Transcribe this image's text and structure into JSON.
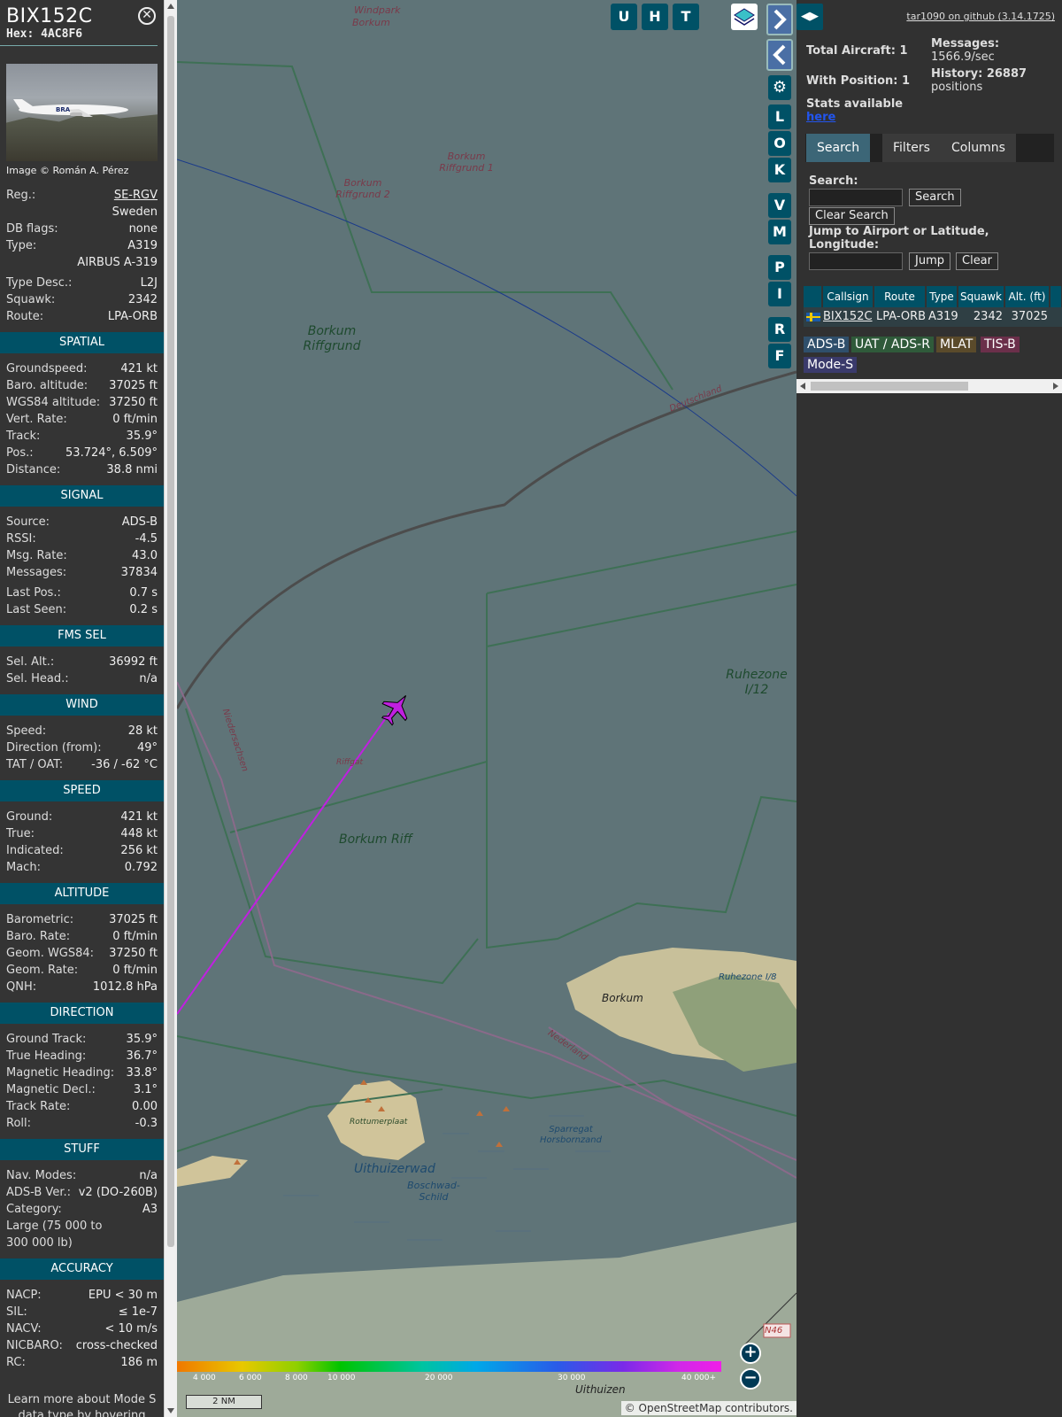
{
  "info": {
    "callsign": "BIX152C",
    "hex": "Hex: 4AC8F6",
    "image_credit": "Image © Román A. Pérez",
    "basic": [
      {
        "label": "Reg.:",
        "value": "SE-RGV"
      },
      {
        "label": "",
        "value": "Sweden"
      },
      {
        "label": "DB flags:",
        "value": "none"
      },
      {
        "label": "Type:",
        "value": "A319"
      },
      {
        "label": "",
        "value": "AIRBUS A-319"
      },
      {
        "label": "Type Desc.:",
        "value": "L2J"
      },
      {
        "label": "Squawk:",
        "value": "2342"
      },
      {
        "label": "Route:",
        "value": "LPA-ORB"
      }
    ],
    "spatial_title": "SPATIAL",
    "spatial": [
      {
        "label": "Groundspeed:",
        "value": "421 kt"
      },
      {
        "label": "Baro. altitude:",
        "value": "37025 ft"
      },
      {
        "label": "WGS84 altitude:",
        "value": "37250 ft"
      },
      {
        "label": "Vert. Rate:",
        "value": "0 ft/min"
      },
      {
        "label": "Track:",
        "value": "35.9°"
      },
      {
        "label": "Pos.:",
        "value": "53.724°, 6.509°"
      },
      {
        "label": "Distance:",
        "value": "38.8 nmi"
      }
    ],
    "signal_title": "SIGNAL",
    "signal": [
      {
        "label": "Source:",
        "value": "ADS-B"
      },
      {
        "label": "RSSI:",
        "value": "-4.5"
      },
      {
        "label": "Msg. Rate:",
        "value": "43.0"
      },
      {
        "label": "Messages:",
        "value": "37834"
      },
      {
        "label": "Last Pos.:",
        "value": "0.7 s"
      },
      {
        "label": "Last Seen:",
        "value": "0.2 s"
      }
    ],
    "fms_title": "FMS SEL",
    "fms": [
      {
        "label": "Sel. Alt.:",
        "value": "36992 ft"
      },
      {
        "label": "Sel. Head.:",
        "value": "n/a"
      }
    ],
    "wind_title": "WIND",
    "wind": [
      {
        "label": "Speed:",
        "value": "28 kt"
      },
      {
        "label": "Direction (from):",
        "value": "49°"
      },
      {
        "label": "TAT / OAT:",
        "value": "-36 / -62 °C"
      }
    ],
    "speed_title": "SPEED",
    "speed": [
      {
        "label": "Ground:",
        "value": "421 kt"
      },
      {
        "label": "True:",
        "value": "448 kt"
      },
      {
        "label": "Indicated:",
        "value": "256 kt"
      },
      {
        "label": "Mach:",
        "value": "0.792"
      }
    ],
    "altitude_title": "ALTITUDE",
    "altitude": [
      {
        "label": "Barometric:",
        "value": "37025 ft"
      },
      {
        "label": "Baro. Rate:",
        "value": "0 ft/min"
      },
      {
        "label": "Geom. WGS84:",
        "value": "37250 ft"
      },
      {
        "label": "Geom. Rate:",
        "value": "0 ft/min"
      },
      {
        "label": "QNH:",
        "value": "1012.8 hPa"
      }
    ],
    "direction_title": "DIRECTION",
    "direction": [
      {
        "label": "Ground Track:",
        "value": "35.9°"
      },
      {
        "label": "True Heading:",
        "value": "36.7°"
      },
      {
        "label": "Magnetic Heading:",
        "value": "33.8°"
      },
      {
        "label": "Magnetic Decl.:",
        "value": "3.1°"
      },
      {
        "label": "Track Rate:",
        "value": "0.00"
      },
      {
        "label": "Roll:",
        "value": "-0.3"
      }
    ],
    "stuff_title": "STUFF",
    "stuff": [
      {
        "label": "Nav. Modes:",
        "value": "n/a"
      },
      {
        "label": "ADS-B Ver.:",
        "value": "v2 (DO-260B)"
      },
      {
        "label": "Category:",
        "value": "A3"
      }
    ],
    "category_desc": "Large (75 000 to 300 000 lb)",
    "accuracy_title": "ACCURACY",
    "accuracy": [
      {
        "label": "NACP:",
        "value": "EPU < 30 m"
      },
      {
        "label": "SIL:",
        "value": "≤ 1e-7"
      },
      {
        "label": "NACV:",
        "value": "< 10 m/s"
      },
      {
        "label": "NICBARO:",
        "value": "cross-checked"
      },
      {
        "label": "RC:",
        "value": "186 m"
      }
    ],
    "note": "Learn more about Mode S data type by hovering over each data label."
  },
  "map": {
    "labels": [
      {
        "text": "Windpark"
      },
      {
        "text": "Borkum"
      },
      {
        "text": "Borkum Riffgrund 1"
      },
      {
        "text": "Borkum Riffgrund 2"
      },
      {
        "text": "Borkum Riffgrund"
      },
      {
        "text": "Ruhezone I/12"
      },
      {
        "text": "Borkum Riff"
      },
      {
        "text": "Riffgat"
      },
      {
        "text": "Deutschland"
      },
      {
        "text": "Niedersachsen"
      },
      {
        "text": "Nederland"
      },
      {
        "text": "Borkum"
      },
      {
        "text": "Rottumerplaat"
      },
      {
        "text": "Uithuizerwad"
      },
      {
        "text": "Boschwad-Schild"
      },
      {
        "text": "Sparregat Horsbornzand"
      },
      {
        "text": "Ruhezone I/8"
      },
      {
        "text": "Uithuizen"
      },
      {
        "text": "N46"
      }
    ],
    "buttons": [
      "U",
      "H",
      "T"
    ],
    "side_buttons": [
      "L",
      "O",
      "K",
      "V",
      "M",
      "P",
      "I",
      "R",
      "F"
    ],
    "alt_labels": [
      "4 000",
      "6 000",
      "8 000",
      "10 000",
      "20 000",
      "30 000",
      "40 000+"
    ],
    "scale": "2 NM",
    "attribution": "© OpenStreetMap contributors."
  },
  "side": {
    "version": "tar1090 on github (3.14.1725)",
    "total_aircraft": "Total Aircraft: 1",
    "with_position": "With Position: 1",
    "stats": "Stats available",
    "stats_link": "here",
    "messages_label": "Messages:",
    "messages_value": "1566.9/sec",
    "history_label": "History: 26887",
    "history_value": "positions",
    "tabs": [
      "Search",
      "Filters",
      "Columns"
    ],
    "search_label": "Search:",
    "search_button": "Search",
    "clear_search": "Clear Search",
    "jump_label": "Jump to Airport or Latitude, Longitude:",
    "jump_button": "Jump",
    "clear_button": "Clear",
    "columns": [
      "Callsign",
      "Route",
      "Type",
      "Squawk",
      "Alt. (ft)"
    ],
    "rows": [
      {
        "callsign": "BIX152C",
        "route": "LPA-ORB",
        "type": "A319",
        "squawk": "2342",
        "alt": "37025"
      }
    ],
    "legend": [
      {
        "label": "ADS-B",
        "color": "#2f4f6b"
      },
      {
        "label": "UAT / ADS-R",
        "color": "#2f5a3a"
      },
      {
        "label": "MLAT",
        "color": "#5a4a2a"
      },
      {
        "label": "TIS-B",
        "color": "#6b2f4a"
      },
      {
        "label": "Mode-S",
        "color": "#3a3a6b"
      }
    ]
  }
}
